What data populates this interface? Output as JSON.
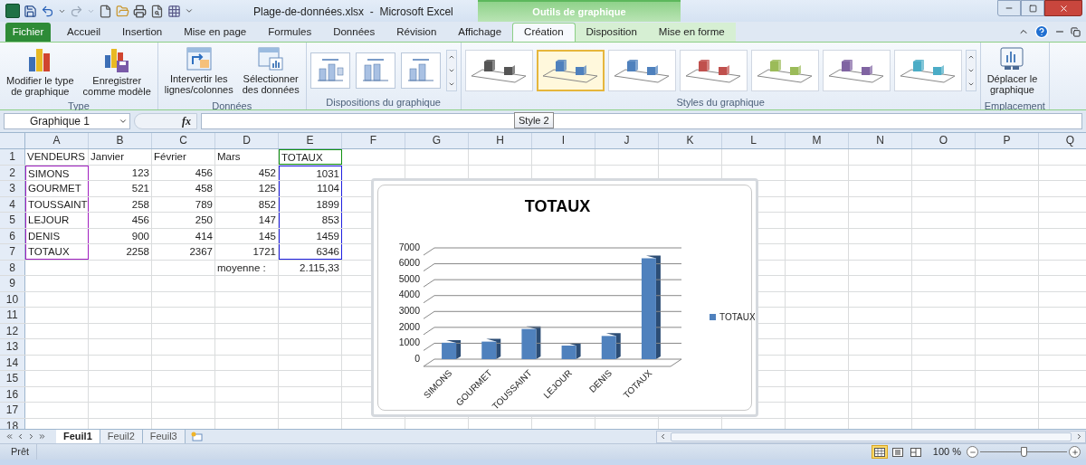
{
  "window": {
    "title": "Plage-de-données.xlsx  -  Microsoft Excel"
  },
  "contextual_group": {
    "label": "Outils de graphique"
  },
  "file_tab": {
    "label": "Fichier"
  },
  "tabs": [
    {
      "label": "Accueil",
      "selected": false
    },
    {
      "label": "Insertion",
      "selected": false
    },
    {
      "label": "Mise en page",
      "selected": false
    },
    {
      "label": "Formules",
      "selected": false
    },
    {
      "label": "Données",
      "selected": false
    },
    {
      "label": "Révision",
      "selected": false
    },
    {
      "label": "Affichage",
      "selected": false
    },
    {
      "label": "Création",
      "selected": true
    },
    {
      "label": "Disposition",
      "selected": false
    },
    {
      "label": "Mise en forme",
      "selected": false
    }
  ],
  "ribbon": {
    "groups": [
      {
        "label": "Type",
        "kind": "buttons",
        "buttons": [
          {
            "label": "Modifier le type\nde graphique",
            "kind": "chart-type"
          },
          {
            "label": "Enregistrer\ncomme modèle",
            "kind": "save-template"
          }
        ]
      },
      {
        "label": "Données",
        "kind": "buttons",
        "buttons": [
          {
            "label": "Intervertir les\nlignes/colonnes",
            "kind": "switch"
          },
          {
            "label": "Sélectionner\ndes données",
            "kind": "select-data"
          }
        ]
      },
      {
        "label": "Dispositions du graphique",
        "kind": "layouts"
      },
      {
        "label": "Styles du graphique",
        "kind": "styles",
        "styles": [
          {
            "color": "#555555",
            "selected": false
          },
          {
            "color": "#4f81bd",
            "selected": true
          },
          {
            "color": "#4f81bd",
            "selected": false
          },
          {
            "color": "#c0504d",
            "selected": false
          },
          {
            "color": "#9bbb59",
            "selected": false
          },
          {
            "color": "#8064a2",
            "selected": false
          },
          {
            "color": "#4bacc6",
            "selected": false
          }
        ]
      },
      {
        "label": "Emplacement",
        "kind": "buttons",
        "buttons": [
          {
            "label": "Déplacer le\ngraphique",
            "kind": "move-chart"
          }
        ]
      }
    ]
  },
  "tooltip": {
    "text": "Style 2"
  },
  "formula_bar": {
    "name_box": "Graphique 1",
    "function_label": "fx"
  },
  "grid": {
    "columns": [
      "A",
      "B",
      "C",
      "D",
      "E",
      "F",
      "G",
      "H",
      "I",
      "J",
      "K",
      "L",
      "M",
      "N",
      "O",
      "P",
      "Q"
    ],
    "rows": [
      {
        "header": "1",
        "cells": [
          {
            "text": "VENDEURS",
            "kind": "text"
          },
          {
            "text": "Janvier",
            "kind": "text"
          },
          {
            "text": "Février",
            "kind": "text"
          },
          {
            "text": "Mars",
            "kind": "text"
          },
          {
            "text": "TOTAUX",
            "kind": "text",
            "color": "#109010"
          }
        ]
      },
      {
        "header": "2",
        "cells": [
          {
            "text": "SIMONS",
            "kind": "text",
            "color": "#a020c0"
          },
          {
            "text": "123",
            "kind": "number"
          },
          {
            "text": "456",
            "kind": "number"
          },
          {
            "text": "452",
            "kind": "number"
          },
          {
            "text": "1031",
            "kind": "number",
            "color": "#2020e0"
          }
        ]
      },
      {
        "header": "3",
        "cells": [
          {
            "text": "GOURMET",
            "kind": "text",
            "color": "#a020c0"
          },
          {
            "text": "521",
            "kind": "number"
          },
          {
            "text": "458",
            "kind": "number"
          },
          {
            "text": "125",
            "kind": "number"
          },
          {
            "text": "1104",
            "kind": "number",
            "color": "#2020e0"
          }
        ]
      },
      {
        "header": "4",
        "cells": [
          {
            "text": "TOUSSAINT",
            "kind": "text",
            "color": "#a020c0"
          },
          {
            "text": "258",
            "kind": "number"
          },
          {
            "text": "789",
            "kind": "number"
          },
          {
            "text": "852",
            "kind": "number"
          },
          {
            "text": "1899",
            "kind": "number",
            "color": "#2020e0"
          }
        ]
      },
      {
        "header": "5",
        "cells": [
          {
            "text": "LEJOUR",
            "kind": "text",
            "color": "#a020c0"
          },
          {
            "text": "456",
            "kind": "number"
          },
          {
            "text": "250",
            "kind": "number"
          },
          {
            "text": "147",
            "kind": "number"
          },
          {
            "text": "853",
            "kind": "number",
            "color": "#2020e0"
          }
        ]
      },
      {
        "header": "6",
        "cells": [
          {
            "text": "DENIS",
            "kind": "text",
            "color": "#a020c0"
          },
          {
            "text": "900",
            "kind": "number"
          },
          {
            "text": "414",
            "kind": "number"
          },
          {
            "text": "145",
            "kind": "number"
          },
          {
            "text": "1459",
            "kind": "number",
            "color": "#2020e0"
          }
        ]
      },
      {
        "header": "7",
        "cells": [
          {
            "text": "TOTAUX",
            "kind": "text",
            "color": "#a020c0"
          },
          {
            "text": "2258",
            "kind": "number"
          },
          {
            "text": "2367",
            "kind": "number"
          },
          {
            "text": "1721",
            "kind": "number"
          },
          {
            "text": "6346",
            "kind": "number",
            "color": "#2020e0"
          }
        ]
      },
      {
        "header": "8",
        "cells": [
          null,
          null,
          null,
          {
            "text": "moyenne :",
            "kind": "text"
          },
          {
            "text": "2.115,33",
            "kind": "number"
          }
        ]
      },
      {
        "header": "9"
      },
      {
        "header": "10"
      },
      {
        "header": "11"
      },
      {
        "header": "12"
      },
      {
        "header": "13"
      },
      {
        "header": "14"
      },
      {
        "header": "15"
      },
      {
        "header": "16"
      },
      {
        "header": "17"
      },
      {
        "header": "18"
      }
    ]
  },
  "chart": {
    "chart_data": {
      "type": "bar",
      "title": "TOTAUX",
      "categories": [
        "SIMONS",
        "GOURMET",
        "TOUSSAINT",
        "LEJOUR",
        "DENIS",
        "TOTAUX"
      ],
      "series": [
        {
          "name": "TOTAUX",
          "color": "#4f81bd",
          "values": [
            1031,
            1104,
            1899,
            853,
            1459,
            6346
          ]
        }
      ],
      "grid": true,
      "ylim": [
        0,
        7000
      ],
      "yticks": [
        0,
        1000,
        2000,
        3000,
        4000,
        5000,
        6000,
        7000
      ]
    }
  },
  "sheet_tabs": [
    {
      "label": "Feuil1",
      "selected": true
    },
    {
      "label": "Feuil2",
      "selected": false
    },
    {
      "label": "Feuil3",
      "selected": false
    }
  ],
  "status_bar": {
    "status": "Prêt",
    "views": [
      {
        "kind": "normal",
        "selected": true
      },
      {
        "kind": "page-layout",
        "selected": false
      },
      {
        "kind": "page-break",
        "selected": false
      }
    ],
    "zoom": "100 %",
    "zoom_slider": {
      "level": 0.5
    }
  }
}
